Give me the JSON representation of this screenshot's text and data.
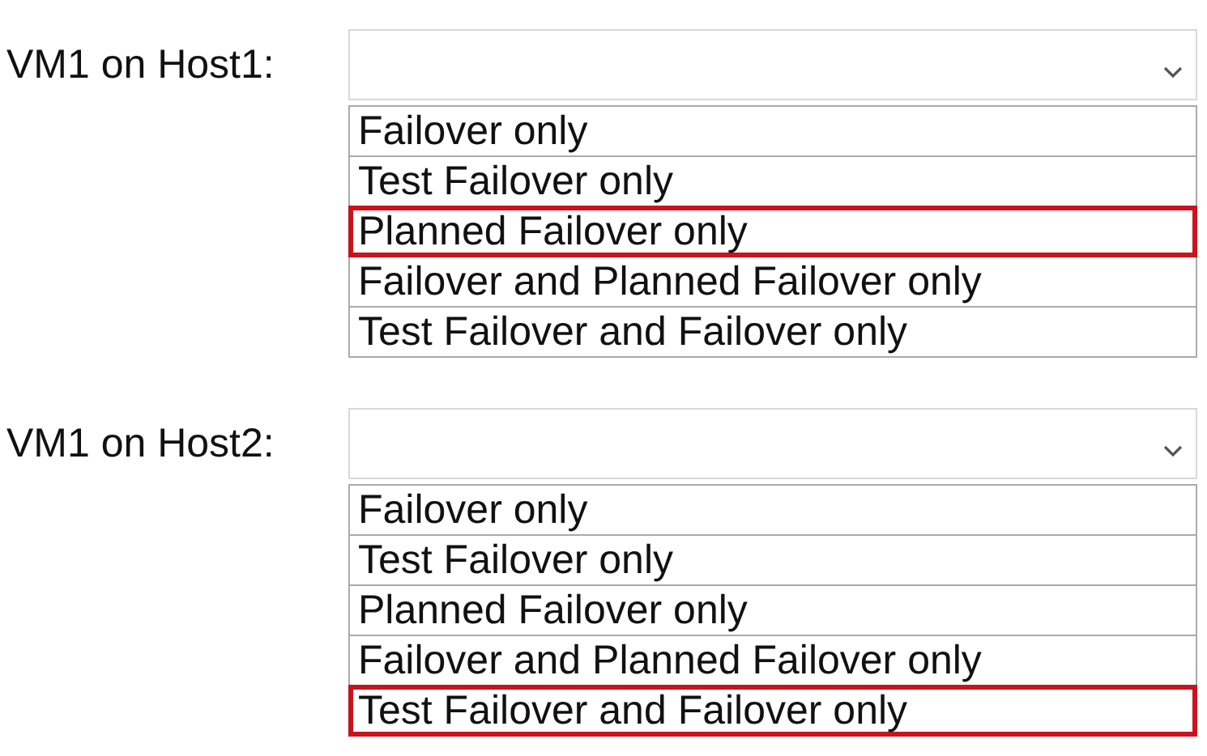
{
  "questions": [
    {
      "label": "VM1 on Host1:",
      "options": [
        {
          "label": "Failover only",
          "selected": false
        },
        {
          "label": "Test Failover only",
          "selected": false
        },
        {
          "label": "Planned Failover only",
          "selected": true
        },
        {
          "label": "Failover and Planned Failover only",
          "selected": false
        },
        {
          "label": "Test Failover and Failover only",
          "selected": false
        }
      ]
    },
    {
      "label": "VM1 on Host2:",
      "options": [
        {
          "label": "Failover only",
          "selected": false
        },
        {
          "label": "Test Failover only",
          "selected": false
        },
        {
          "label": "Planned Failover only",
          "selected": false
        },
        {
          "label": "Failover and Planned Failover only",
          "selected": false
        },
        {
          "label": "Test Failover and Failover only",
          "selected": true
        }
      ]
    }
  ]
}
